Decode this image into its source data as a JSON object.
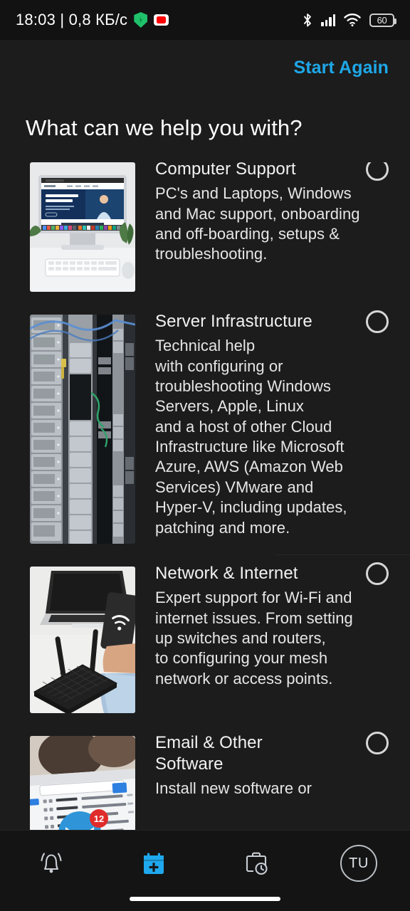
{
  "status_bar": {
    "clock": "18:03 | 0,8 КБ/с",
    "shield_icon": "shield-icon",
    "youtube_icon": "youtube-icon",
    "bluetooth_icon": "bluetooth-icon",
    "signal_icon": "cellular-signal-icon",
    "wifi_icon": "wifi-icon",
    "battery_level": "60"
  },
  "header": {
    "start_again_label": "Start Again"
  },
  "main": {
    "title": "What can we help you with?",
    "items": [
      {
        "title": "Computer Support",
        "description": "PC's and Laptops, Windows\nand Mac support, onboarding\nand off-boarding, setups &\ntroubleshooting.",
        "thumbnail": "desktop-computer-photo",
        "radio_name": "radio-computer-support",
        "selected": false
      },
      {
        "title": "Server Infrastructure",
        "description": "Technical help\nwith configuring or\ntroubleshooting Windows\nServers, Apple, Linux\nand a host of other Cloud\nInfrastructure like Microsoft\nAzure, AWS (Amazon Web\nServices) VMware and\nHyper-V, including updates,\npatching and more.",
        "thumbnail": "server-racks-photo",
        "radio_name": "radio-server-infrastructure",
        "selected": false
      },
      {
        "title": "Network & Internet",
        "description": "Expert support for Wi-Fi and\ninternet issues. From setting\nup switches and routers,\nto configuring your mesh\nnetwork or access points.",
        "thumbnail": "router-laptop-photo",
        "radio_name": "radio-network-internet",
        "selected": false
      },
      {
        "title": "Email & Other\nSoftware",
        "description": "Install new software or",
        "thumbnail": "email-inbox-photo",
        "radio_name": "radio-email-other-software",
        "selected": false
      }
    ]
  },
  "bottom_nav": {
    "items": [
      {
        "name": "notifications-tab",
        "icon": "bell-icon",
        "active": false
      },
      {
        "name": "new-booking-tab",
        "icon": "calendar-plus-icon",
        "active": true
      },
      {
        "name": "history-tab",
        "icon": "briefcase-clock-icon",
        "active": false
      },
      {
        "name": "profile-tab",
        "icon": "avatar-icon",
        "initials": "TU",
        "active": false
      }
    ]
  },
  "colors": {
    "background": "#1c1c1c",
    "accent": "#1ea7e8",
    "status_bar_bg": "#121212",
    "nav_bg": "#141414",
    "text_primary": "#f2f2f2"
  }
}
